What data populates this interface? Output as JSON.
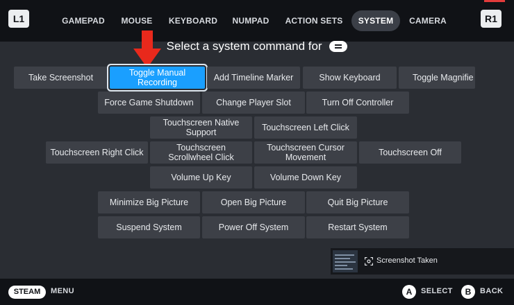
{
  "header": {
    "left_shoulder": "L1",
    "right_shoulder": "R1",
    "tabs": [
      {
        "label": "GAMEPAD",
        "active": false
      },
      {
        "label": "MOUSE",
        "active": false
      },
      {
        "label": "KEYBOARD",
        "active": false
      },
      {
        "label": "NUMPAD",
        "active": false
      },
      {
        "label": "ACTION SETS",
        "active": false
      },
      {
        "label": "SYSTEM",
        "active": true
      },
      {
        "label": "CAMERA",
        "active": false
      }
    ]
  },
  "prompt": {
    "text": "Select a system command for",
    "glyph": "menu-button-icon"
  },
  "annotation": {
    "arrow_color": "#e8291c"
  },
  "commands": [
    {
      "label": "Take Screenshot",
      "selected": false
    },
    {
      "label": "Toggle Manual Recording",
      "selected": true
    },
    {
      "label": "Add Timeline Marker",
      "selected": false
    },
    {
      "label": "Show Keyboard",
      "selected": false
    },
    {
      "label": "Toggle Magnifie",
      "selected": false
    },
    {
      "label": "Force Game Shutdown",
      "selected": false
    },
    {
      "label": "Change Player Slot",
      "selected": false
    },
    {
      "label": "Turn Off Controller",
      "selected": false
    },
    {
      "label": "Touchscreen Native Support",
      "selected": false
    },
    {
      "label": "Touchscreen Left Click",
      "selected": false
    },
    {
      "label": "Touchscreen Right Click",
      "selected": false
    },
    {
      "label": "Touchscreen Scrollwheel Click",
      "selected": false
    },
    {
      "label": "Touchscreen Cursor Movement",
      "selected": false
    },
    {
      "label": "Touchscreen Off",
      "selected": false
    },
    {
      "label": "Volume Up Key",
      "selected": false
    },
    {
      "label": "Volume Down Key",
      "selected": false
    },
    {
      "label": "Minimize Big Picture",
      "selected": false
    },
    {
      "label": "Open Big Picture",
      "selected": false
    },
    {
      "label": "Quit Big Picture",
      "selected": false
    },
    {
      "label": "Suspend System",
      "selected": false
    },
    {
      "label": "Power Off System",
      "selected": false
    },
    {
      "label": "Restart System",
      "selected": false
    }
  ],
  "toast": {
    "text": "Screenshot Taken",
    "icon": "screenshot-icon"
  },
  "footer": {
    "steam": "STEAM",
    "menu": "MENU",
    "a_glyph": "A",
    "select": "SELECT",
    "b_glyph": "B",
    "back": "BACK"
  },
  "colors": {
    "background": "#2a2d33",
    "bar": "#101216",
    "button": "#3d4047",
    "selected": "#1a9fff"
  }
}
